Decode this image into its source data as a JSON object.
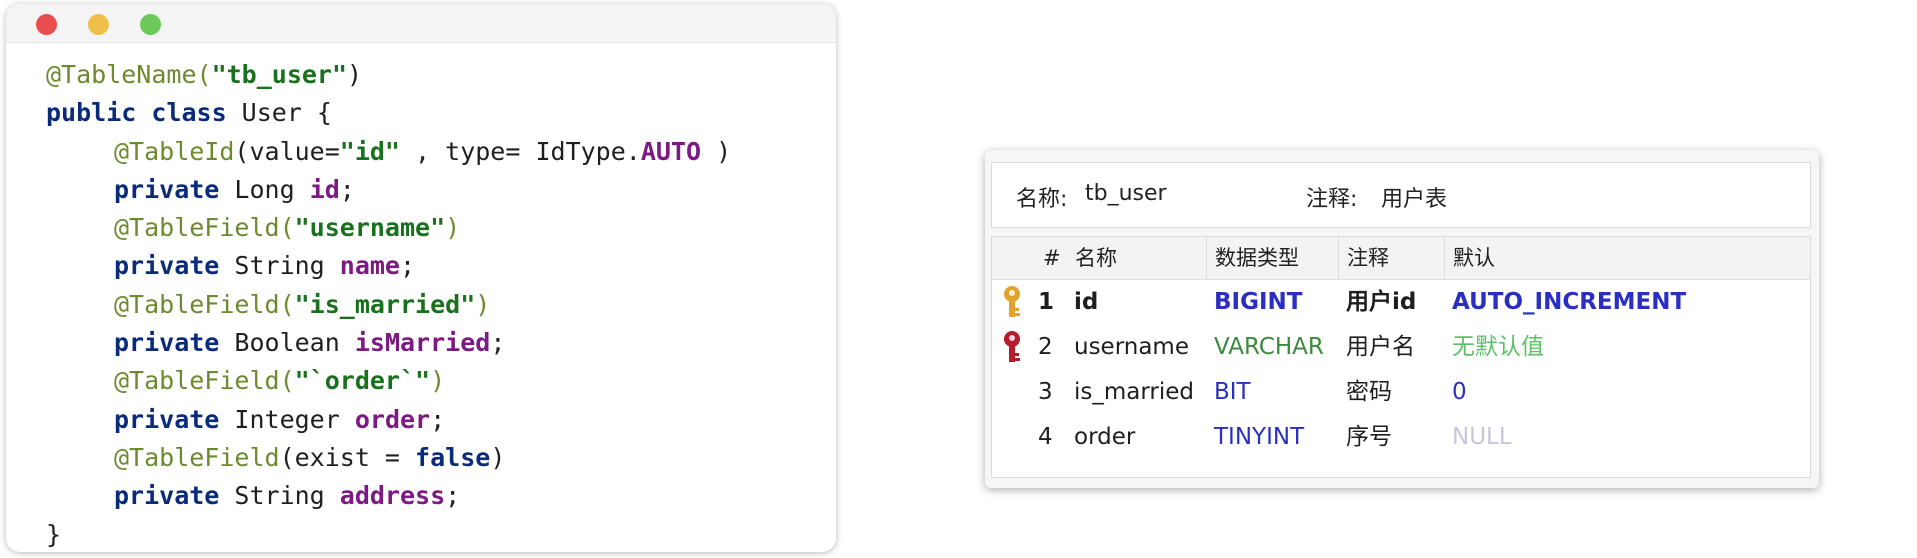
{
  "code_window": {
    "lines": [
      [
        "@TableName(",
        "\"tb_user\"",
        ")"
      ],
      [
        "public class ",
        "User {"
      ],
      [
        "@TableId",
        "(value=",
        "\"id\"",
        " , type= IdType.",
        "AUTO",
        " )"
      ],
      [
        "private ",
        "Long ",
        "id",
        ";"
      ],
      [
        "@TableField(",
        "\"username\"",
        ")"
      ],
      [
        "private ",
        "String ",
        "name",
        ";"
      ],
      [
        "@TableField(",
        "\"is_married\"",
        ")"
      ],
      [
        "private ",
        "Boolean ",
        "isMarried",
        ";"
      ],
      [
        "@TableField(",
        "\"`order`\"",
        ")"
      ],
      [
        "private ",
        "Integer ",
        "order",
        ";"
      ],
      [
        "@TableField",
        "(exist = ",
        "false",
        ")"
      ],
      [
        "private ",
        "String ",
        "address",
        ";"
      ],
      [
        "}"
      ]
    ]
  },
  "table_panel": {
    "name_label": "名称:",
    "name_value": "tb_user",
    "comment_label": "注释:",
    "comment_value": "用户表",
    "headers": [
      "#",
      "名称",
      "数据类型",
      "注释",
      "默认"
    ],
    "rows": [
      {
        "num": "1",
        "name": "id",
        "type": "BIGINT",
        "comment": "用户id",
        "default": "AUTO_INCREMENT",
        "key": "primary-key"
      },
      {
        "num": "2",
        "name": "username",
        "type": "VARCHAR",
        "comment": "用户名",
        "default": "无默认值",
        "key": "unique-key"
      },
      {
        "num": "3",
        "name": "is_married",
        "type": "BIT",
        "comment": "密码",
        "default": "0",
        "key": ""
      },
      {
        "num": "4",
        "name": "order",
        "type": "TINYINT",
        "comment": "序号",
        "default": "NULL",
        "key": ""
      }
    ]
  },
  "colors": {
    "annotation": "#6d8a2e",
    "keyword": "#0a2a7a",
    "string": "#19701d",
    "field": "#7c1982",
    "type_column": "#2a2fc1",
    "primary_key_icon": "#e2a12a",
    "unique_key_icon": "#b81c2a"
  }
}
